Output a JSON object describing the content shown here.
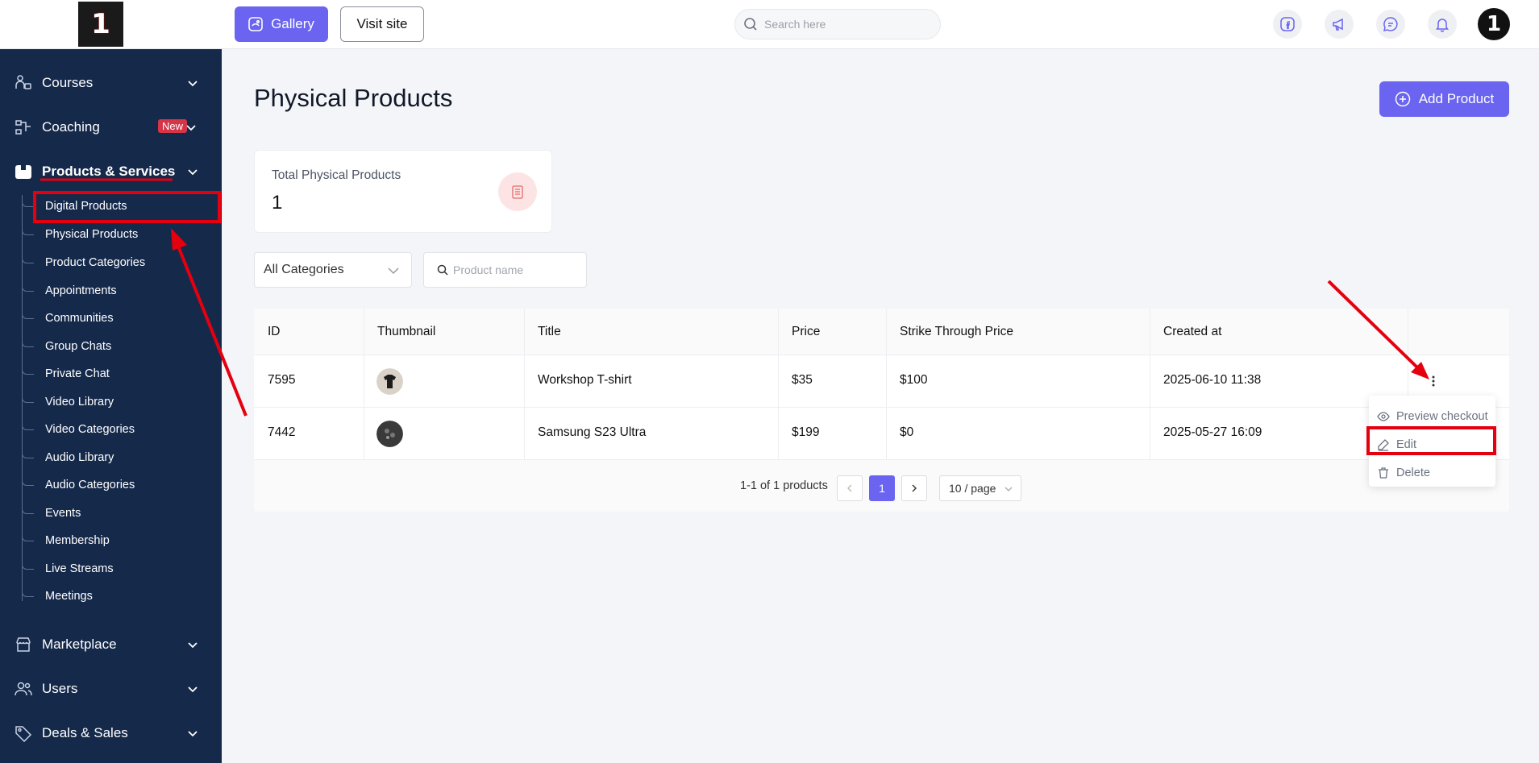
{
  "logo_text": "1",
  "sidebar": {
    "items": [
      {
        "label": "Courses"
      },
      {
        "label": "Coaching",
        "badge": "New"
      },
      {
        "label": "Products & Services"
      },
      {
        "label": "Marketplace"
      },
      {
        "label": "Users"
      },
      {
        "label": "Deals & Sales"
      }
    ],
    "sub_items": [
      "Digital Products",
      "Physical Products",
      "Product Categories",
      "Appointments",
      "Communities",
      "Group Chats",
      "Private Chat",
      "Video Library",
      "Video Categories",
      "Audio Library",
      "Audio Categories",
      "Events",
      "Membership",
      "Live Streams",
      "Meetings"
    ]
  },
  "topbar": {
    "gallery_label": "Gallery",
    "visit_label": "Visit site",
    "search_placeholder": "Search here",
    "avatar_text": "1"
  },
  "main": {
    "title": "Physical Products",
    "add_label": "Add Product",
    "stat": {
      "label": "Total Physical Products",
      "value": "1"
    },
    "category_select": "All Categories",
    "product_search_placeholder": "Product name"
  },
  "table": {
    "headers": [
      "ID",
      "Thumbnail",
      "Title",
      "Price",
      "Strike Through Price",
      "Created at"
    ],
    "rows": [
      {
        "id": "7595",
        "title": "Workshop T-shirt",
        "price": "$35",
        "strike": "$100",
        "created": "2025-06-10 11:38"
      },
      {
        "id": "7442",
        "title": "Samsung S23 Ultra",
        "price": "$199",
        "strike": "$0",
        "created": "2025-05-27 16:09"
      }
    ],
    "pagination": {
      "summary": "1-1 of 1 products",
      "current_page": "1",
      "page_size": "10 / page"
    }
  },
  "row_menu": {
    "items": [
      "Preview checkout",
      "Edit",
      "Delete"
    ]
  },
  "colors": {
    "sidebar_bg": "#15294b",
    "accent": "#6a64f1",
    "annotation_red": "#e5000f"
  }
}
